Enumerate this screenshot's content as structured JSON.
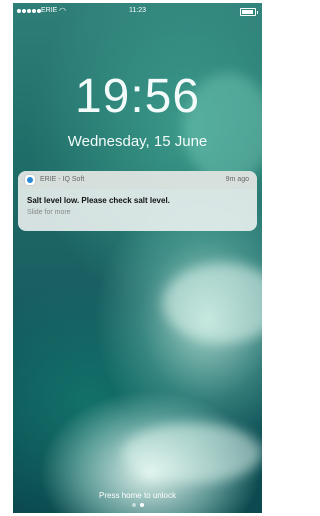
{
  "status_bar": {
    "carrier": "ERIE",
    "time": "11:23"
  },
  "lock_screen": {
    "clock": "19:56",
    "date": "Wednesday, 15 June"
  },
  "notification": {
    "app_name": "ERIE - IQ Soft",
    "age": "9m ago",
    "message": "Salt level low.  Please check salt level.",
    "hint": "Slide for more"
  },
  "footer": {
    "unlock_hint": "Press home to unlock"
  },
  "icons": [
    "signal-dots-icon",
    "wifi-icon",
    "battery-icon",
    "app-icon"
  ]
}
